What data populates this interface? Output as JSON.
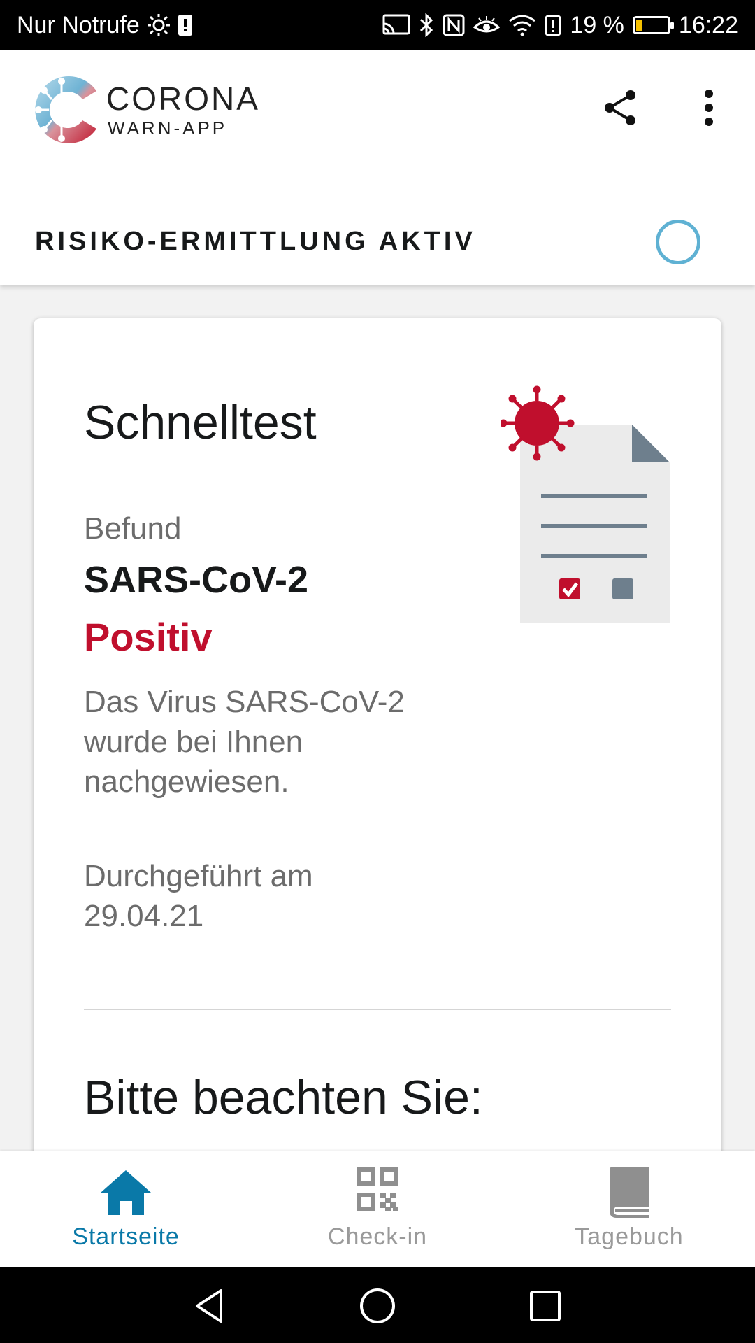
{
  "status_bar": {
    "carrier": "Nur Notrufe",
    "battery_percent": "19 %",
    "battery_level": 0.19,
    "time": "16:22",
    "icons": [
      "brightness-icon",
      "sim-alert-icon",
      "cast-icon",
      "bluetooth-icon",
      "nfc-icon",
      "eye-comfort-icon",
      "wifi-icon",
      "battery-alert-icon",
      "battery-icon"
    ]
  },
  "app_bar": {
    "logo_line1": "CORONA",
    "logo_line2": "WARN-APP",
    "share_icon": "share-icon",
    "more_icon": "more-vert-icon",
    "risk_status": "RISIKO-ERMITTLUNG AKTIV"
  },
  "card": {
    "title": "Schnelltest",
    "befund_label": "Befund",
    "virus_name": "SARS-CoV-2",
    "result": "Positiv",
    "description": "Das Virus SARS-CoV-2 wurde bei Ihnen nachgewiesen.",
    "performed_label": "Durchgeführt am",
    "performed_date": "29.04.21",
    "note_title": "Bitte beachten Sie:"
  },
  "bottom_nav": {
    "items": [
      {
        "label": "Startseite",
        "icon": "home-icon",
        "active": true
      },
      {
        "label": "Check-in",
        "icon": "qr-code-icon",
        "active": false
      },
      {
        "label": "Tagebuch",
        "icon": "book-icon",
        "active": false
      }
    ]
  },
  "colors": {
    "accent": "#0a79a8",
    "positive_red": "#c00f2d",
    "risk_ring": "#5fb1d3",
    "inactive_nav": "#9a9a9a"
  }
}
